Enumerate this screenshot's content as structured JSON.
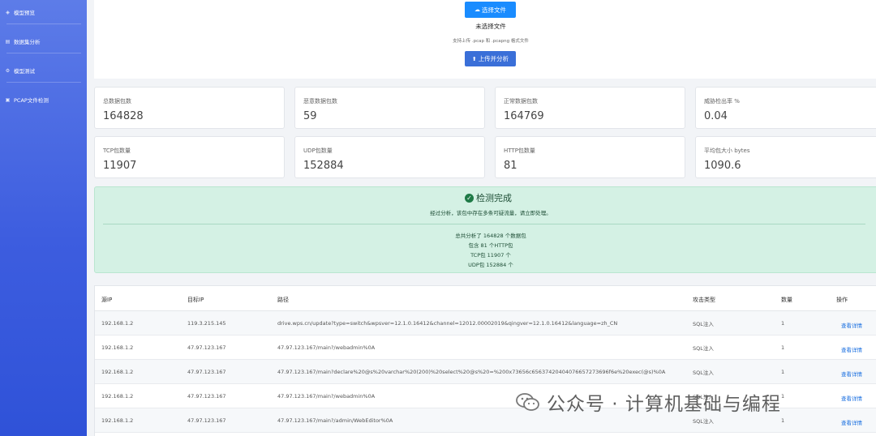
{
  "sidebar": {
    "items": [
      {
        "label": "模型预览",
        "icon": "model-icon"
      },
      {
        "label": "数据集分析",
        "icon": "dataset-icon"
      },
      {
        "label": "模型测试",
        "icon": "gear-icon"
      },
      {
        "label": "PCAP文件检测",
        "icon": "file-check-icon"
      }
    ]
  },
  "upload": {
    "choose_label": "选择文件",
    "no_file": "未选择文件",
    "hint": "支持上传 .pcap 和 .pcapng 格式文件",
    "upload_label": "上传并分析"
  },
  "stats": [
    {
      "label": "总数据包数",
      "value": "164828"
    },
    {
      "label": "恶意数据包数",
      "value": "59"
    },
    {
      "label": "正常数据包数",
      "value": "164769"
    },
    {
      "label": "威胁检出率 %",
      "value": "0.04"
    },
    {
      "label": "TCP包数量",
      "value": "11907"
    },
    {
      "label": "UDP包数量",
      "value": "152884"
    },
    {
      "label": "HTTP包数量",
      "value": "81"
    },
    {
      "label": "平均包大小 bytes",
      "value": "1090.6"
    }
  ],
  "result": {
    "title": "检测完成",
    "message": "经过分析，该包中存在多条可疑流量，请立即处理。",
    "summary": [
      "总共分析了 164828 个数据包",
      "包含 81 个HTTP包",
      "TCP包 11907 个",
      "UDP包 152884 个"
    ],
    "color": "#d4f1e4"
  },
  "table": {
    "headers": [
      "源IP",
      "目标IP",
      "路径",
      "攻击类型",
      "数量",
      "操作"
    ],
    "rows": [
      {
        "src": "192.168.1.2",
        "dst": "119.3.215.145",
        "path": "drive.wps.cn/update?type=switch&wpsver=12.1.0.16412&channel=12012.00002019&qingver=12.1.0.16412&language=zh_CN",
        "type": "SQL注入",
        "count": "1",
        "action": "查看详情"
      },
      {
        "src": "192.168.1.2",
        "dst": "47.97.123.167",
        "path": "47.97.123.167/main?/webadmin%0A",
        "type": "SQL注入",
        "count": "1",
        "action": "查看详情"
      },
      {
        "src": "192.168.1.2",
        "dst": "47.97.123.167",
        "path": "47.97.123.167/main?declare%20@s%20varchar%20(200)%20select%20@s%20=%200x73656c65637420404076657273696f6e%20exec(@s)%0A",
        "type": "SQL注入",
        "count": "1",
        "action": "查看详情"
      },
      {
        "src": "192.168.1.2",
        "dst": "47.97.123.167",
        "path": "47.97.123.167/main?/webadmin%0A",
        "type": "SQL注入",
        "count": "1",
        "action": "查看详情"
      },
      {
        "src": "192.168.1.2",
        "dst": "47.97.123.167",
        "path": "47.97.123.167/main?/admin/WebEditor%0A",
        "type": "SQL注入",
        "count": "1",
        "action": "查看详情"
      }
    ]
  },
  "watermark": {
    "text": "公众号 · 计算机基础与编程",
    "icon": "wechat-icon"
  },
  "colors": {
    "sidebar": "#3d5ddf",
    "primary": "#1a8cff",
    "link": "#1a6fe0",
    "success": "#1e7a46"
  }
}
